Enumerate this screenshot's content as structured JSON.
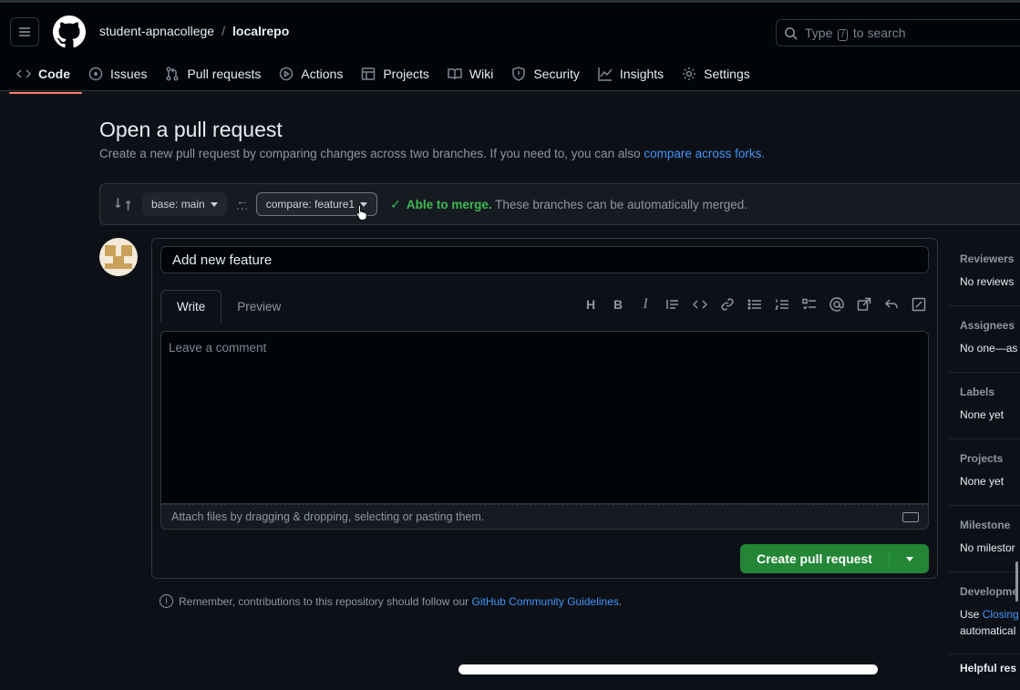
{
  "header": {
    "owner": "student-apnacollege",
    "separator": "/",
    "repo": "localrepo",
    "search_prefix": "Type",
    "search_key": "/",
    "search_suffix": "to search"
  },
  "tabs": [
    {
      "label": "Code",
      "icon": "code-icon"
    },
    {
      "label": "Issues",
      "icon": "issue-icon"
    },
    {
      "label": "Pull requests",
      "icon": "pull-request-icon"
    },
    {
      "label": "Actions",
      "icon": "play-icon"
    },
    {
      "label": "Projects",
      "icon": "table-icon"
    },
    {
      "label": "Wiki",
      "icon": "book-icon"
    },
    {
      "label": "Security",
      "icon": "shield-icon"
    },
    {
      "label": "Insights",
      "icon": "graph-icon"
    },
    {
      "label": "Settings",
      "icon": "gear-icon"
    }
  ],
  "page": {
    "title": "Open a pull request",
    "subtitle": "Create a new pull request by comparing changes across two branches. If you need to, you can also",
    "subtitle_link": "compare across forks."
  },
  "compare": {
    "base": "base: main",
    "head": "compare: feature1",
    "merge_status": "Able to merge.",
    "merge_detail": "These branches can be automatically merged."
  },
  "form": {
    "title_value": "Add new feature",
    "tab_write": "Write",
    "tab_preview": "Preview",
    "comment_placeholder": "Leave a comment",
    "attach_hint": "Attach files by dragging & dropping, selecting or pasting them.",
    "submit_label": "Create pull request"
  },
  "note": {
    "text": "Remember, contributions to this repository should follow our",
    "link": "GitHub Community Guidelines",
    "end": "."
  },
  "sidebar": {
    "reviewers": {
      "head": "Reviewers",
      "value": "No reviews"
    },
    "assignees": {
      "head": "Assignees",
      "value": "No one—as"
    },
    "labels": {
      "head": "Labels",
      "value": "None yet"
    },
    "projects": {
      "head": "Projects",
      "value": "None yet"
    },
    "milestone": {
      "head": "Milestone",
      "value": "No milestor"
    },
    "development": {
      "head": "Developme",
      "use": "Use",
      "link": "Closing",
      "extra": "automatical"
    },
    "helpful": "Helpful res"
  },
  "colors": {
    "background": "#0d1117",
    "accent_tab": "#f78166",
    "link": "#4493f8",
    "success": "#3fb950",
    "button": "#238636"
  }
}
